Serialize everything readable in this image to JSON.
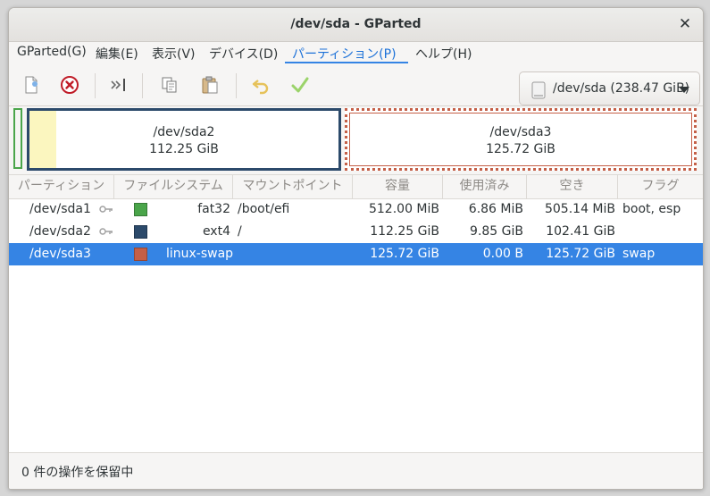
{
  "window": {
    "title": "/dev/sda - GParted"
  },
  "menu": [
    {
      "label": "GParted(G)"
    },
    {
      "label": "編集(E)"
    },
    {
      "label": "表示(V)"
    },
    {
      "label": "デバイス(D)"
    },
    {
      "label": "パーティション(P)"
    },
    {
      "label": "ヘルプ(H)"
    }
  ],
  "toolbar": {
    "device_label": "/dev/sda (238.47 GiB)"
  },
  "diskmap": {
    "sda2": {
      "name": "/dev/sda2",
      "size": "112.25 GiB",
      "used_fraction": 0.088
    },
    "sda3": {
      "name": "/dev/sda3",
      "size": "125.72 GiB"
    }
  },
  "table": {
    "headers": [
      "パーティション",
      "ファイルシステム",
      "マウントポイント",
      "容量",
      "使用済み",
      "空き",
      "フラグ"
    ],
    "rows": [
      {
        "partition": "/dev/sda1",
        "fs": "fat32",
        "fs_color": "#4aa54a",
        "mount": "/boot/efi",
        "size": "512.00 MiB",
        "used": "6.86 MiB",
        "unused": "505.14 MiB",
        "flags": "boot, esp",
        "locked": true,
        "selected": false
      },
      {
        "partition": "/dev/sda2",
        "fs": "ext4",
        "fs_color": "#2c4a6b",
        "mount": "/",
        "size": "112.25 GiB",
        "used": "9.85 GiB",
        "unused": "102.41 GiB",
        "flags": "",
        "locked": true,
        "selected": false
      },
      {
        "partition": "/dev/sda3",
        "fs": "linux-swap",
        "fs_color": "#c45f47",
        "mount": "",
        "size": "125.72 GiB",
        "used": "0.00 B",
        "unused": "125.72 GiB",
        "flags": "swap",
        "locked": false,
        "selected": true
      }
    ]
  },
  "status": {
    "text": "0 件の操作を保留中"
  },
  "colors": {
    "accent": "#3584e4",
    "fat32": "#4aa54a",
    "ext4": "#2c4a6b",
    "swap": "#c45f47"
  }
}
